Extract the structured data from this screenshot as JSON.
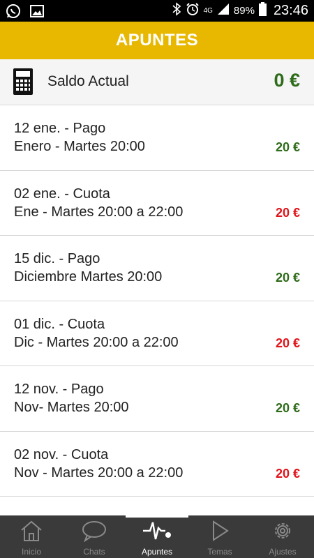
{
  "status": {
    "battery": "89%",
    "time": "23:46",
    "network": "4G"
  },
  "header": {
    "title": "APUNTES"
  },
  "balance": {
    "label": "Saldo Actual",
    "amount": "0 €",
    "icon": "calculator-icon"
  },
  "entries": [
    {
      "line1": "12 ene. - Pago",
      "line2": "Enero - Martes 20:00",
      "amount": "20 €",
      "type": "credit"
    },
    {
      "line1": "02 ene. - Cuota",
      "line2": "Ene - Martes 20:00 a 22:00",
      "amount": "20 €",
      "type": "debit"
    },
    {
      "line1": "15 dic. - Pago",
      "line2": "Diciembre Martes 20:00",
      "amount": "20 €",
      "type": "credit"
    },
    {
      "line1": "01 dic. - Cuota",
      "line2": "Dic - Martes 20:00 a 22:00",
      "amount": "20 €",
      "type": "debit"
    },
    {
      "line1": "12 nov. - Pago",
      "line2": "Nov- Martes 20:00",
      "amount": "20 €",
      "type": "credit"
    },
    {
      "line1": "02 nov. - Cuota",
      "line2": "Nov - Martes 20:00 a 22:00",
      "amount": "20 €",
      "type": "debit"
    }
  ],
  "nav": {
    "tabs": [
      {
        "label": "Inicio",
        "icon": "home-icon"
      },
      {
        "label": "Chats",
        "icon": "chat-icon"
      },
      {
        "label": "Apuntes",
        "icon": "pulse-icon",
        "active": true
      },
      {
        "label": "Temas",
        "icon": "play-icon"
      },
      {
        "label": "Ajustes",
        "icon": "gear-icon"
      }
    ]
  },
  "colors": {
    "accent": "#E8B800",
    "credit": "#2e6b1a",
    "debit": "#e0141b",
    "nav_bg": "#3a3a3a"
  }
}
